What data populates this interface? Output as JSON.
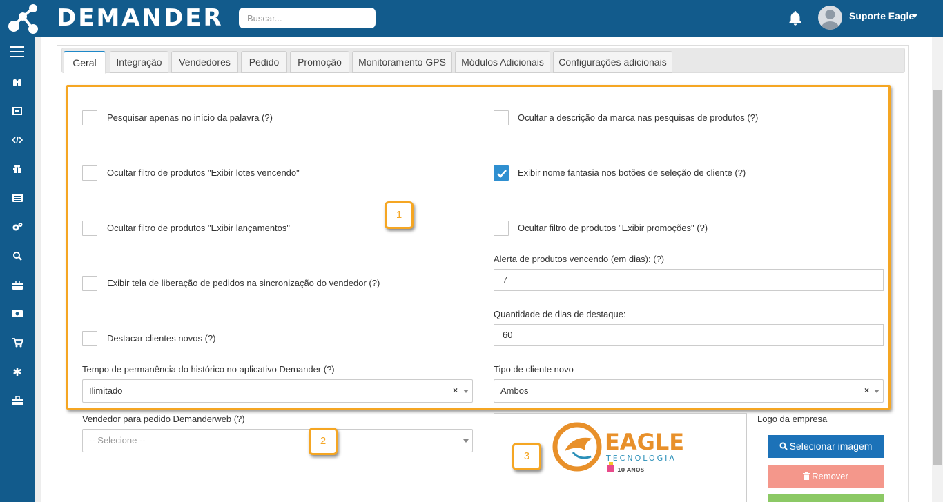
{
  "header": {
    "brand": "DEMANDER",
    "search_placeholder": "Buscar...",
    "user_name": "Suporte Eagle"
  },
  "sidebar": {
    "items": [
      "menu-icon",
      "binoculars-icon",
      "dashboard-icon",
      "code-icon",
      "gift-icon",
      "list-icon",
      "gears-icon",
      "search-icon",
      "briefcase-icon",
      "money-icon",
      "cart-icon",
      "asterisk-icon",
      "toolbox-icon"
    ]
  },
  "tabs": [
    {
      "label": "Geral",
      "active": true
    },
    {
      "label": "Integração",
      "active": false
    },
    {
      "label": "Vendedores",
      "active": false
    },
    {
      "label": "Pedido",
      "active": false
    },
    {
      "label": "Promoção",
      "active": false
    },
    {
      "label": "Monitoramento GPS",
      "active": false
    },
    {
      "label": "Módulos Adicionais",
      "active": false
    },
    {
      "label": "Configurações adicionais",
      "active": false
    }
  ],
  "checkboxes": [
    {
      "label": "Pesquisar apenas no início da palavra (?)",
      "checked": false
    },
    {
      "label": "Ocultar a descrição da marca nas pesquisas de produtos (?)",
      "checked": false
    },
    {
      "label": "Ocultar filtro de produtos \"Exibir lotes vencendo\"",
      "checked": false
    },
    {
      "label": "Exibir nome fantasia nos botões de seleção de cliente (?)",
      "checked": true
    },
    {
      "label": "Ocultar filtro de produtos \"Exibir lançamentos\"",
      "checked": false
    },
    {
      "label": "Ocultar filtro de produtos \"Exibir promoções\" (?)",
      "checked": false
    },
    {
      "label": "Exibir tela de liberação de pedidos na sincronização do vendedor (?)",
      "checked": false
    },
    {
      "label": "Destacar clientes novos (?)",
      "checked": false
    }
  ],
  "fields": {
    "alerta_label": "Alerta de produtos vencendo (em dias): (?)",
    "alerta_value": "7",
    "destaque_label": "Quantidade de dias de destaque:",
    "destaque_value": "60",
    "tempo_label": "Tempo de permanência do histórico no aplicativo Demander (?)",
    "tempo_value": "Ilimitado",
    "tipo_label": "Tipo de cliente novo",
    "tipo_value": "Ambos",
    "vendedor_label": "Vendedor para pedido Demanderweb (?)",
    "vendedor_placeholder": "-- Selecione --",
    "clear_symbol": "×"
  },
  "logo": {
    "section_label": "Logo da empresa",
    "image_text_main": "EAGLE",
    "image_text_sub": "TECNOLOGIA",
    "image_text_anniv": "10 ANOS",
    "select_button": "Selecionar imagem",
    "remove_button": "Remover"
  },
  "annotations": [
    "1",
    "2",
    "3"
  ],
  "colors": {
    "brand": "#125b8c",
    "highlight": "#f5a623",
    "checkbox_checked": "#2f8fd0",
    "btn_select": "#1c72b8",
    "btn_remove": "#f4978b",
    "btn_green": "#8cc965"
  }
}
